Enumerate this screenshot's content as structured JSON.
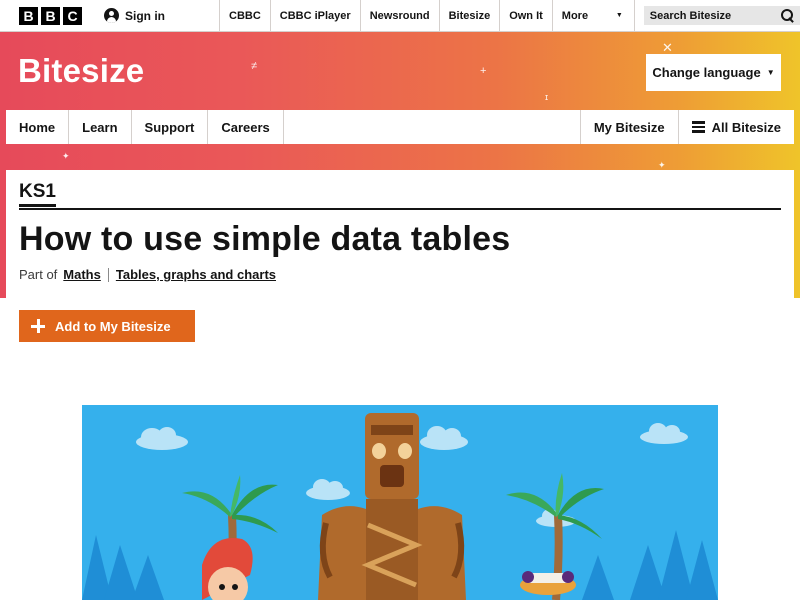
{
  "global_nav": {
    "logo_letters": [
      "B",
      "B",
      "C"
    ],
    "sign_in": "Sign in",
    "links": [
      "CBBC",
      "CBBC iPlayer",
      "Newsround",
      "Bitesize",
      "Own It"
    ],
    "more_label": "More",
    "search_placeholder": "Search Bitesize"
  },
  "masthead": {
    "brand": "Bitesize",
    "change_language": "Change language",
    "nav_left": [
      "Home",
      "Learn",
      "Support",
      "Careers"
    ],
    "my_bitesize": "My Bitesize",
    "all_bitesize": "All Bitesize"
  },
  "article": {
    "level": "KS1",
    "title": "How to use simple data tables",
    "part_of_label": "Part of",
    "subject": "Maths",
    "topic": "Tables, graphs and charts",
    "add_button": "Add to My Bitesize"
  },
  "colors": {
    "masthead_start": "#e64a5a",
    "masthead_end": "#efc42a",
    "add_button": "#e0661c",
    "hero_sky": "#35b0ec"
  }
}
